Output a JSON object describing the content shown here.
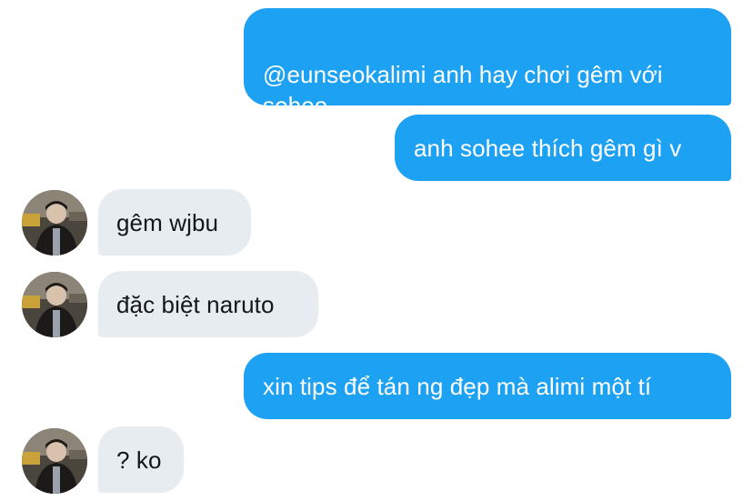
{
  "conversation": {
    "messages": [
      {
        "sender": "me",
        "text": "@eunseokalimi anh hay chơi gêm với\nsohee"
      },
      {
        "sender": "me",
        "text": "anh sohee thích gêm gì v"
      },
      {
        "sender": "other",
        "text": "gêm wjbu"
      },
      {
        "sender": "other",
        "text": "đặc biệt naruto"
      },
      {
        "sender": "me",
        "text": "xin tips để tán ng đẹp mà alimi một tí"
      },
      {
        "sender": "other",
        "text": "? ko"
      }
    ]
  },
  "colors": {
    "outgoing_bubble": "#1da1f2",
    "incoming_bubble": "#e6ecf0",
    "incoming_text": "#14171a",
    "outgoing_text": "#ffffff"
  },
  "icons": {
    "avatar": "user-avatar-photo"
  }
}
